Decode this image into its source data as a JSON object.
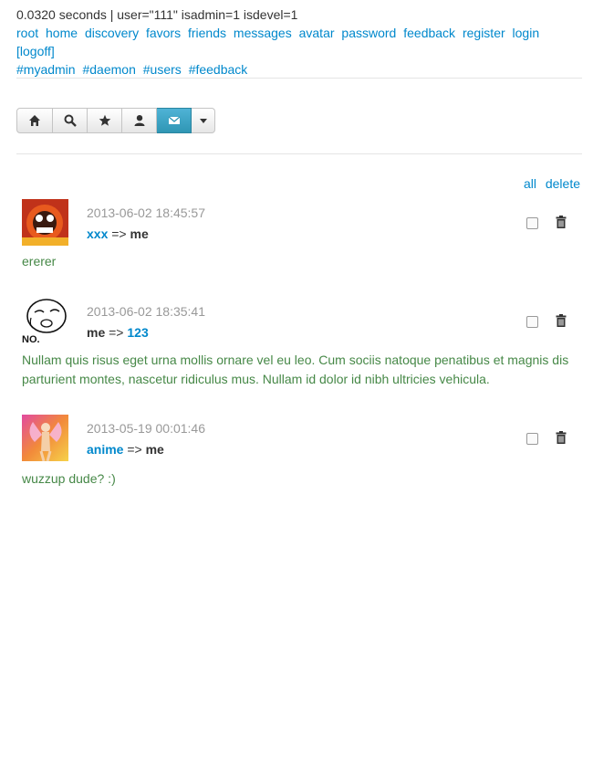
{
  "debug": "0.0320 seconds | user=\"111\" isadmin=1 isdevel=1",
  "nav": {
    "links": [
      "root",
      "home",
      "discovery",
      "favors",
      "friends",
      "messages",
      "avatar",
      "password",
      "feedback",
      "register",
      "login",
      "[logoff]",
      "#myadmin",
      "#daemon",
      "#users",
      "#feedback"
    ]
  },
  "toolbar": {
    "buttons": [
      {
        "icon": "home-icon"
      },
      {
        "icon": "search-icon"
      },
      {
        "icon": "star-icon"
      },
      {
        "icon": "user-icon"
      },
      {
        "icon": "envelope-icon",
        "active": true
      }
    ],
    "dropdown_icon": "caret-down-icon"
  },
  "actions": {
    "all": "all",
    "delete": "delete"
  },
  "messages": [
    {
      "timestamp": "2013-06-02 18:45:57",
      "from": "xxx",
      "arrow": "=>",
      "to": "me",
      "from_link": true,
      "to_link": false,
      "body": "ererer"
    },
    {
      "timestamp": "2013-06-02 18:35:41",
      "from": "me",
      "arrow": "=>",
      "to": "123",
      "from_link": false,
      "to_link": true,
      "body": "Nullam quis risus eget urna mollis ornare vel eu leo. Cum sociis natoque penatibus et magnis dis parturient montes, nascetur ridiculus mus. Nullam id dolor id nibh ultricies vehicula."
    },
    {
      "timestamp": "2013-05-19 00:01:46",
      "from": "anime",
      "arrow": "=>",
      "to": "me",
      "from_link": true,
      "to_link": false,
      "body": "wuzzup dude? :)"
    }
  ],
  "avatar_text": {
    "no": "NO."
  }
}
